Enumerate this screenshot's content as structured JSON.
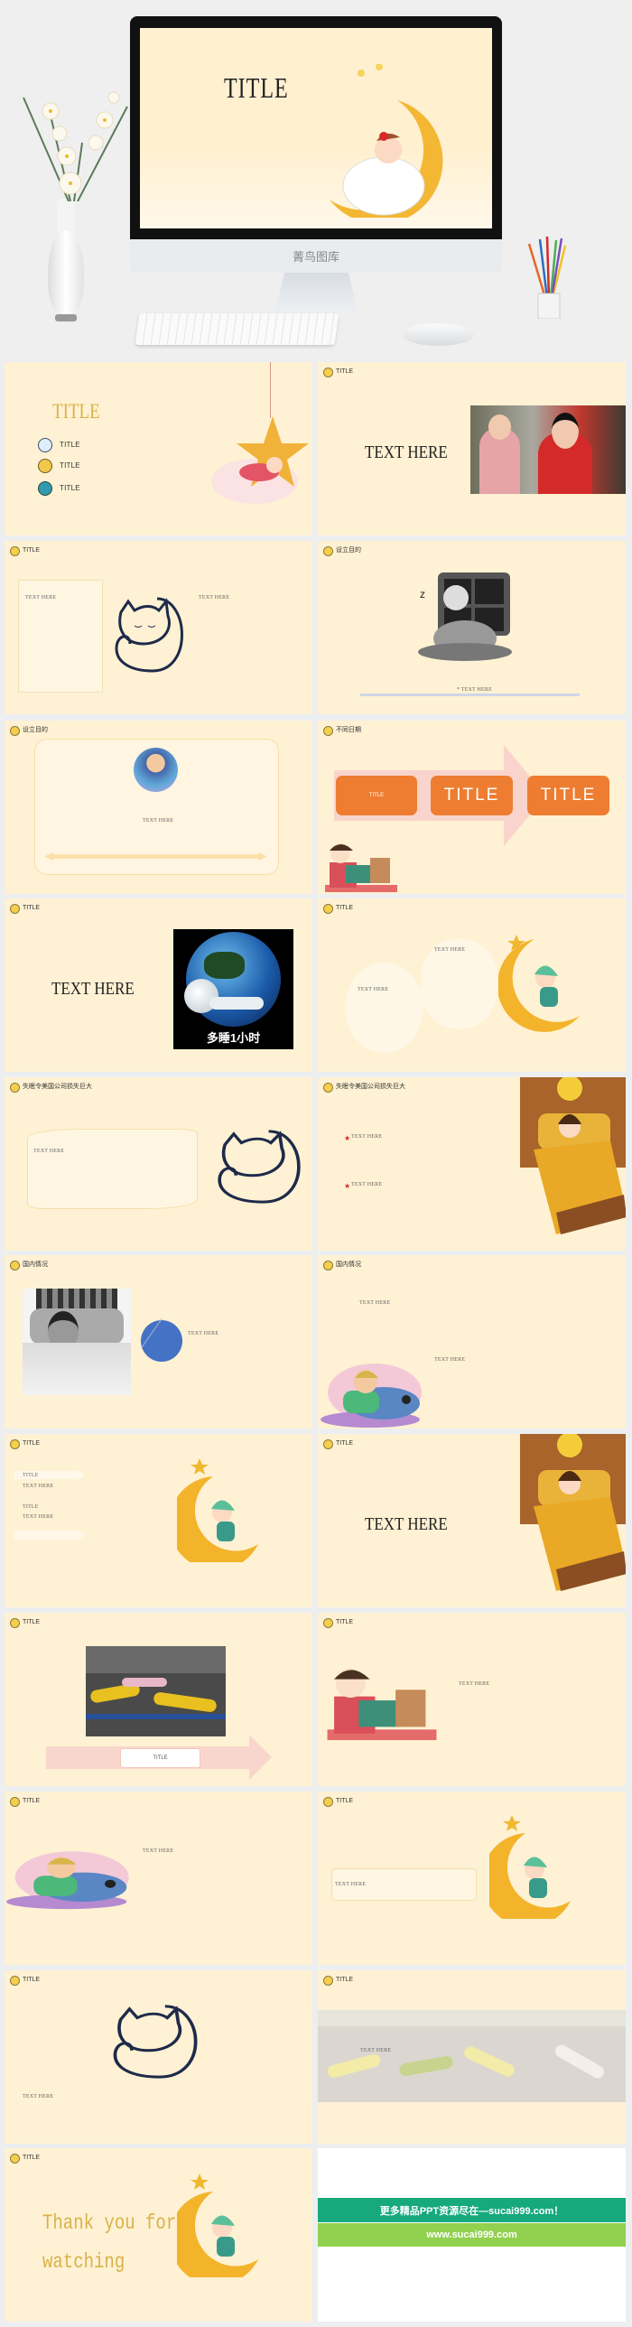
{
  "hero": {
    "title": "TITLE",
    "brand": "菁鸟图库"
  },
  "colors": {
    "slide_bg": "#fff1d3",
    "accent_gold": "#d8b24a",
    "orange": "#ee7d31",
    "banner_green": "#16a97b",
    "banner_lime": "#92d050"
  },
  "slides": [
    {
      "title": "TITLE",
      "items": [
        {
          "icon": "moon-planet-icon",
          "label": "TITLE"
        },
        {
          "icon": "saturn-icon",
          "label": "TITLE"
        },
        {
          "icon": "earth-icon",
          "label": "TITLE"
        }
      ]
    },
    {
      "header": "TITLE",
      "text": "TEXT HERE"
    },
    {
      "header": "TITLE",
      "texts": [
        "TEXT HERE",
        "TEXT HERE"
      ]
    },
    {
      "header": "设立目的",
      "text": "* TEXT HERE"
    },
    {
      "header": "设立目的",
      "text": "TEXT HERE"
    },
    {
      "header": "不同日期",
      "boxes": [
        "TITLE",
        "TITLE",
        "TITLE"
      ]
    },
    {
      "header": "TITLE",
      "text": "TEXT HERE",
      "image_caption": "多睡1小时"
    },
    {
      "header": "TITLE",
      "texts": [
        "TEXT HERE",
        "TEXT HERE"
      ]
    },
    {
      "header": "失眠令美国公司损失巨大",
      "text": "TEXT HERE"
    },
    {
      "header": "失眠令美国公司损失巨大",
      "texts": [
        "TEXT HERE",
        "TEXT HERE"
      ]
    },
    {
      "header": "国内情况",
      "text": "TEXT HERE"
    },
    {
      "header": "国内情况",
      "texts": [
        "TEXT HERE",
        "TEXT HERE"
      ]
    },
    {
      "header": "TITLE",
      "items": [
        "TITLE",
        "TEXT HERE",
        "TITLE",
        "TEXT HERE"
      ]
    },
    {
      "header": "TITLE",
      "text": "TEXT HERE"
    },
    {
      "header": "TITLE",
      "label": "TITLE"
    },
    {
      "header": "TITLE",
      "text": "TEXT HERE"
    },
    {
      "header": "TITLE",
      "text": "TEXT HERE"
    },
    {
      "header": "TITLE",
      "text": "TEXT HERE"
    },
    {
      "header": "TITLE",
      "text": "TEXT HERE"
    },
    {
      "header": "TITLE",
      "text": "TEXT HERE"
    },
    {
      "header": "TITLE",
      "lines": [
        "Thank you for",
        "watching"
      ]
    },
    {
      "banner": "更多精品PPT资源尽在—sucai999.com！",
      "url": "www.sucai999.com"
    }
  ]
}
